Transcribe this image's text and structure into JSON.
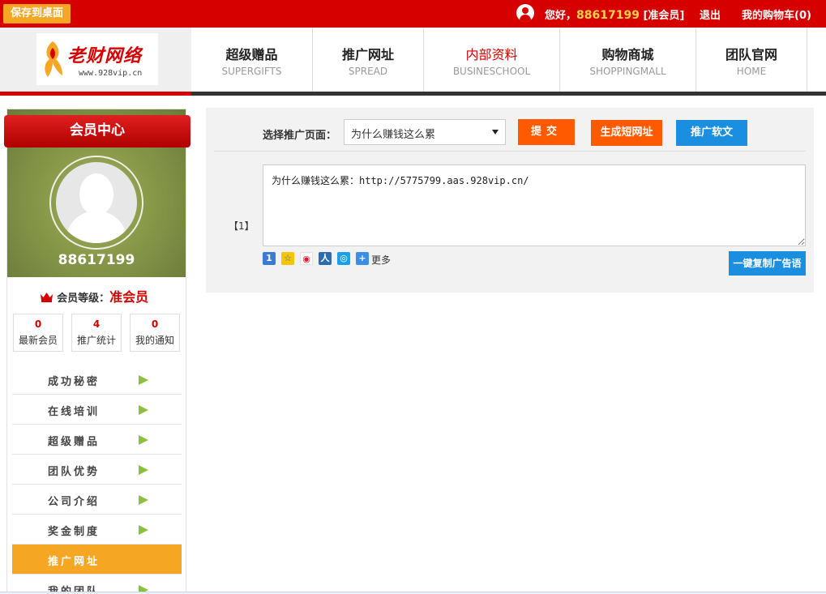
{
  "topbar": {
    "save_label": "保存到桌面",
    "greeting": "您好，",
    "user_id": "88617199",
    "member_tag": "[准会员]",
    "logout": "退出",
    "cart": "我的购物车(0)"
  },
  "logo": {
    "text": "老财网络",
    "url": "www.928vip.cn"
  },
  "nav": {
    "items": [
      {
        "cn": "超级赠品",
        "en": "SUPERGIFTS"
      },
      {
        "cn": "推广网址",
        "en": "SPREAD"
      },
      {
        "cn": "内部资料",
        "en": "BUSINESCHOOL"
      },
      {
        "cn": "购物商城",
        "en": "SHOPPINGMALL"
      },
      {
        "cn": "团队官网",
        "en": "HOME"
      }
    ]
  },
  "sidebar": {
    "title": "会员中心",
    "username": "88617199",
    "level_label": "会员等级：",
    "level_value": "准会员",
    "stats": [
      {
        "num": "0",
        "label": "最新会员"
      },
      {
        "num": "4",
        "label": "推广统计"
      },
      {
        "num": "0",
        "label": "我的通知"
      }
    ],
    "menu": [
      {
        "label": "成功秘密"
      },
      {
        "label": "在线培训"
      },
      {
        "label": "超级赠品"
      },
      {
        "label": "团队优势"
      },
      {
        "label": "公司介绍"
      },
      {
        "label": "奖金制度"
      },
      {
        "label": "推广网址"
      },
      {
        "label": "我的团队"
      }
    ]
  },
  "main": {
    "select_label": "选择推广页面：",
    "select_value": "为什么赚钱这么累",
    "submit": "提交",
    "short_url": "生成短网址",
    "soft_article": "推广软文",
    "index": "【1】",
    "ad_text": "为什么赚钱这么累：http://5775799.aas.928vip.cn/",
    "share_more": "更多",
    "copy": "一键复制广告语"
  },
  "colors": {
    "brand_red": "#d60000",
    "accent_orange": "#f5a623",
    "button_orange": "#ff5a00",
    "button_blue": "#1a8fe0",
    "menu_arrow": "#8cc03c"
  }
}
